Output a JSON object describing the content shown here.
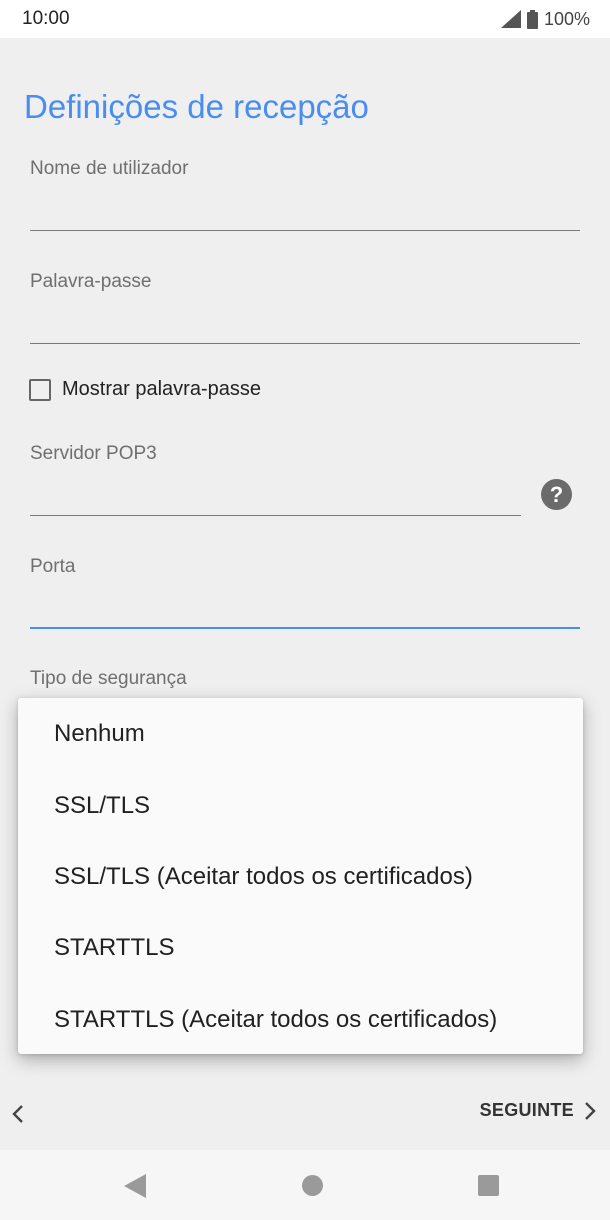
{
  "status_bar": {
    "time": "10:00",
    "battery_text": "100%",
    "icons": [
      "signal-icon",
      "battery-icon"
    ]
  },
  "form": {
    "title": "Definições de recepção",
    "username_label": "Nome de utilizador",
    "password_label": "Palavra-passe",
    "show_password_label": "Mostrar palavra-passe",
    "server_label": "Servidor POP3",
    "port_label": "Porta",
    "security_label": "Tipo de segurança",
    "help_glyph": "?"
  },
  "security_dropdown": {
    "options": [
      "Nenhum",
      "SSL/TLS",
      "SSL/TLS (Aceitar todos os certificados)",
      "STARTTLS",
      "STARTTLS (Aceitar todos os certificados)"
    ]
  },
  "navigation": {
    "next_label": "SEGUINTE"
  },
  "colors": {
    "accent": "#4a8df0",
    "background": "#efefef",
    "menu_background": "#fafafa"
  }
}
